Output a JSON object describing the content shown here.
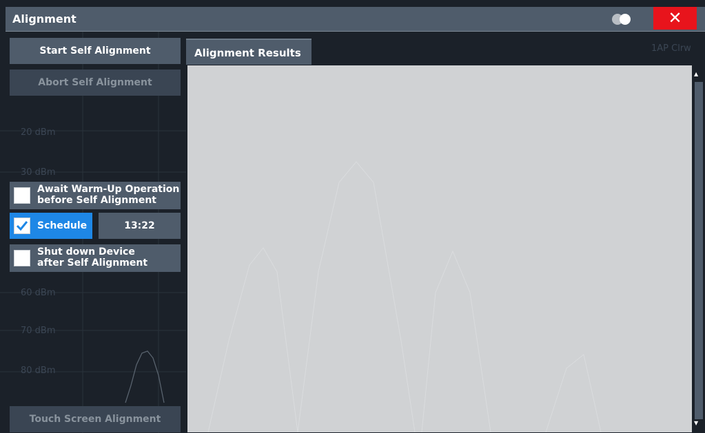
{
  "window": {
    "title": "Alignment",
    "close_label": "✕"
  },
  "actions": {
    "start_self_alignment": "Start Self Alignment",
    "abort_self_alignment": "Abort Self Alignment",
    "touch_screen_alignment": "Touch Screen Alignment"
  },
  "options": {
    "await_warmup_label": "Await Warm-Up Operation\nbefore Self Alignment",
    "await_warmup_checked": false,
    "schedule_label": "Schedule",
    "schedule_checked": true,
    "schedule_time": "13:22",
    "shutdown_label": "Shut down Device\nafter Self Alignment",
    "shutdown_checked": false
  },
  "tabs": [
    {
      "label": "Alignment Results",
      "active": true
    }
  ],
  "background_trace": {
    "ref_labels": [
      "20 dBm",
      "30 dBm",
      "60 dBm",
      "70 dBm",
      "80 dBm"
    ],
    "badge": "1AP Clrw"
  },
  "colors": {
    "accent_blue": "#1e87e6",
    "close_red": "#e8141c",
    "panel": "#4f5c6b",
    "results_bg": "#d0d2d4"
  },
  "icons": {
    "close": "close-icon",
    "toggle": "theme-toggle-icon",
    "check": "check-icon",
    "scroll_up": "arrow-up-icon",
    "scroll_down": "arrow-down-icon"
  }
}
